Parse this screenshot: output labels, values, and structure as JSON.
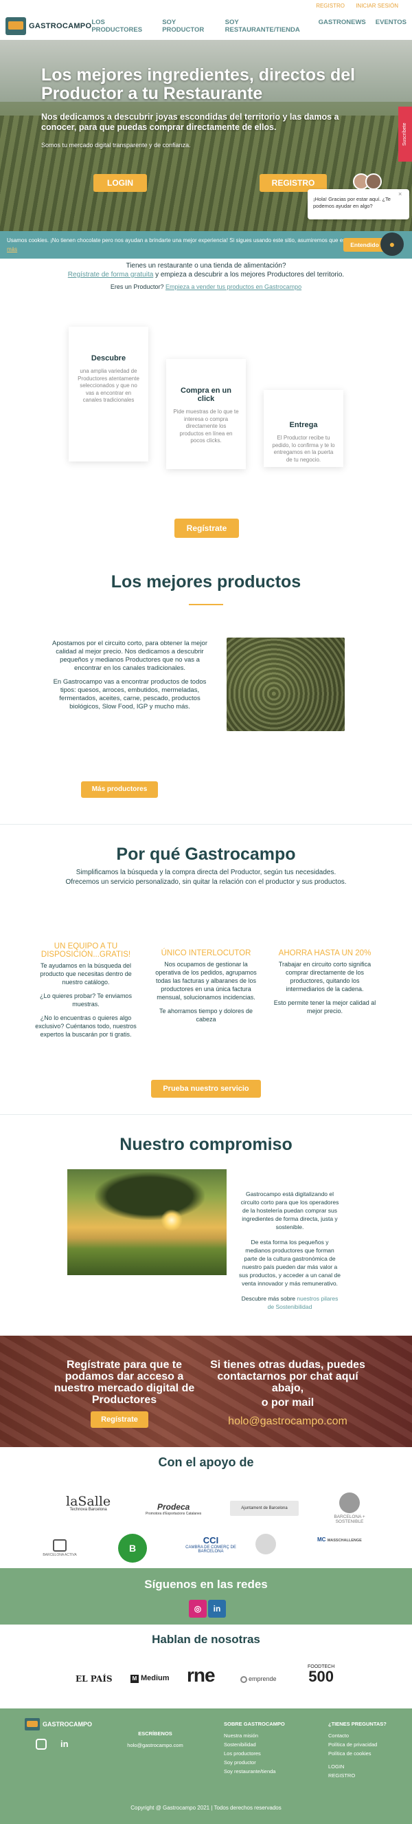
{
  "topbar": {
    "register": "REGISTRO",
    "login": "INICIAR SESIÓN"
  },
  "nav": {
    "brand": "GASTROCAMPO",
    "items": [
      "LOS PRODUCTORES",
      "SOY PRODUCTOR",
      "SOY RESTAURANTE/TIENDA",
      "GASTRONEWS",
      "EVENTOS"
    ]
  },
  "hero": {
    "title": "Los mejores ingredientes, directos del Productor a tu Restaurante",
    "subtitle": "Nos dedicamos a descubrir joyas escondidas del territorio y las damos a conocer, para que puedas comprar directamente de ellos.",
    "tagline": "Somos tu mercado digital transparente y de confianza.",
    "login_button": "LOGIN",
    "register_button": "REGISTRO",
    "side_tab": "Suscríbete"
  },
  "chat": {
    "message": "¡Hola! Gracias por estar aquí. ¿Te podemos ayudar en algo?",
    "close": "×",
    "launcher": "●"
  },
  "cookie": {
    "text": "Usamos cookies. ¡No tienen chocolate pero nos ayudan a brindarte una mejor experiencia! Si sigues usando este sitio, asumiremos que estás de acuerdo :)",
    "more": "Leer más",
    "accept": "Entendido"
  },
  "how": {
    "line1": "Tienes un restaurante o una tienda de alimentación?",
    "line1_link": "Regístrate de forma gratuita",
    "line1_rest": "y empieza a descubrir a los mejores Productores del territorio.",
    "line2": "Eres un Productor?",
    "line2_link": "Empieza a vender tus productos en Gastrocampo",
    "cards": [
      {
        "title": "Descubre",
        "text": "una amplia variedad de Productores atentamente seleccionados y que no vas a encontrar en canales tradicionales"
      },
      {
        "title": "Compra en un click",
        "text": "Pide muestras de lo que te interesa o compra directamente los productos en línea en pocos clicks."
      },
      {
        "title": "Entrega",
        "text": "El Productor recibe tu pedido, lo confirma y te lo entregamos en la puerta de tu negocio."
      }
    ],
    "register_button": "Regístrate"
  },
  "best": {
    "title": "Los mejores productos",
    "p1": "Apostamos por el circuito corto, para obtener la mejor calidad al mejor precio. Nos dedicamos a descubrir pequeños y medianos Productores que no vas a encontrar en los canales tradicionales.",
    "p2": "En Gastrocampo vas a encontrar productos de todos tipos: quesos, arroces, embutidos, mermeladas, fermentados, aceites, carne, pescado, productos biológicos, Slow Food, IGP y mucho más.",
    "button": "Más productores"
  },
  "why": {
    "title": "Por qué Gastrocampo",
    "sub1": "Simplificamos la búsqueda y la compra directa del Productor, según tus necesidades.",
    "sub2": "Ofrecemos un servicio personalizado, sin quitar la relación con el productor y sus productos.",
    "cols": [
      {
        "title": "UN EQUIPO A TU DISPOSICIÓN...GRATIS!",
        "p1": "Te ayudamos en la búsqueda del producto que necesitas dentro de nuestro catálogo.",
        "p2": "¿Lo quieres probar? Te enviamos muestras.",
        "p3": "¿No lo encuentras o quieres algo exclusivo? Cuéntanos todo, nuestros expertos la buscarán por ti gratis."
      },
      {
        "title": "ÚNICO INTERLOCUTOR",
        "p1": "Nos ocupamos de gestionar la operativa de los pedidos, agrupamos todas las facturas y albaranes de los productores en una única factura mensual, solucionamos incidencias.",
        "p2": "Te ahorramos tiempo y dolores de cabeza"
      },
      {
        "title": "AHORRA HASTA UN 20%",
        "p1": "Trabajar en circuito corto significa comprar directamente de los productores, quitando los intermediarios de la cadena.",
        "p2": "Esto permite tener la mejor calidad al mejor precio."
      }
    ],
    "button": "Prueba nuestro servicio"
  },
  "commitment": {
    "title": "Nuestro compromiso",
    "p1": "Gastrocampo está digitalizando el circuito corto para que los operadores de la hostelería puedan comprar sus ingredientes de forma directa, justa y sostenible.",
    "p2": "De esta forma los pequeños y medianos productores que forman parte de la cultura gastronómica de nuestro país pueden dar más valor a sus productos, y acceder a un canal de venta innovador y más remunerativo.",
    "p3": "Descubre más sobre",
    "p3_link": "nuestros pilares de Sostenibilidad"
  },
  "cta": {
    "left": "Regístrate para que te podamos dar acceso a nuestro mercado digital de Productores",
    "left_button": "Regístrate",
    "right": "Si tienes otras dudas, puedes contactarnos por chat aquí abajo,",
    "right_or": "o por mail",
    "email": "holo@gastrocampo.com"
  },
  "support": {
    "title": "Con el apoyo de",
    "logos": {
      "lasalle": "laSalle",
      "lasalle_sub": "Technova Barcelona",
      "prodeca": "Prodeca",
      "prodeca_sub": "Promotora d'Exportacions Catalanes",
      "bcn": "Ajuntament de Barcelona",
      "bcn_sost": "BARCELONA + SOSTENIBLE",
      "fund": "BARCELONA ACTIVA",
      "bio": "B",
      "cc": "CCI",
      "cc_sub": "CAMBRA DE COMERÇ DE BARCELONA",
      "mc": "MC",
      "mc_sub": "MASSCHALLENGE"
    }
  },
  "follow": {
    "title": "Síguenos en las redes",
    "ig": "◎",
    "in": "in"
  },
  "press": {
    "title": "Hablan de nosotras",
    "items": [
      "EL PAÍS",
      "Medium",
      "rne",
      "emprende",
      "500"
    ],
    "medium_mark": "M",
    "p5_top": "FOODTECH"
  },
  "footer": {
    "brand": "GASTROCAMPO",
    "col1_title": "ESCRÍBENOS",
    "col1_email": "holo@gastrocampo.com",
    "col2_title": "SOBRE GASTROCAMPO",
    "col2_items": [
      "Nuestra misión",
      "Sostenibilidad",
      "Los productores",
      "Soy productor",
      "Soy restaurante/tienda"
    ],
    "col3_title": "¿TIENES PREGUNTAS?",
    "col3_items": [
      "Contacto",
      "Política de privacidad",
      "Política de cookies"
    ],
    "col3_login": "LOGIN",
    "col3_register": "REGISTRO",
    "copyright": "Copyright @ Gastrocampo 2021 | Todos derechos reservados",
    "ig": "",
    "in": "in"
  }
}
